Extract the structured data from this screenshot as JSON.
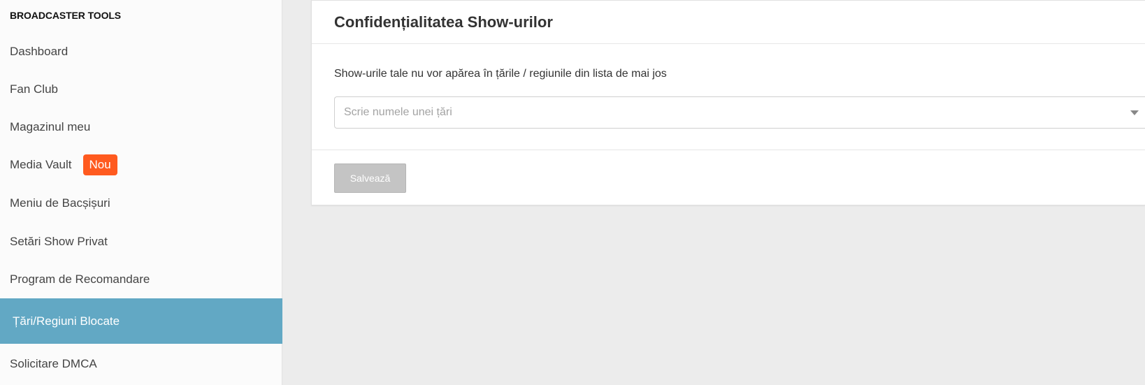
{
  "sidebar": {
    "header": "BROADCASTER TOOLS",
    "items": [
      {
        "label": "Dashboard"
      },
      {
        "label": "Fan Club"
      },
      {
        "label": "Magazinul meu"
      },
      {
        "label": "Media Vault",
        "badge": "Nou"
      },
      {
        "label": "Meniu de Bacșișuri"
      },
      {
        "label": "Setări Show Privat"
      },
      {
        "label": "Program de Recomandare"
      },
      {
        "label": "Țări/Regiuni Blocate",
        "active": true
      },
      {
        "label": "Solicitare DMCA"
      }
    ]
  },
  "panel": {
    "title": "Confidențialitatea Show-urilor",
    "description": "Show-urile tale nu vor apărea în țările / regiunile din lista de mai jos",
    "country_input_placeholder": "Scrie numele unei țări",
    "save_label": "Salvează"
  },
  "colors": {
    "active_item_bg": "#62a8c4",
    "badge_bg": "#ff5a1f",
    "save_button_bg": "#c4c4c4",
    "page_bg": "#ececec"
  }
}
